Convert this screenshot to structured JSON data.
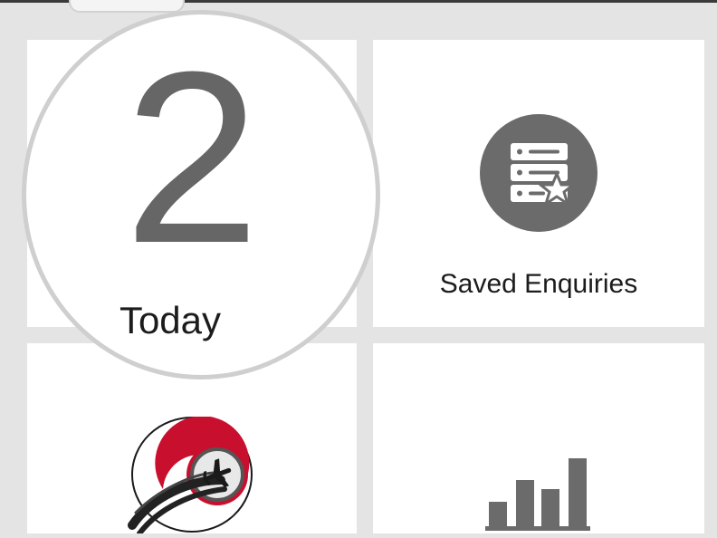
{
  "dashboard": {
    "today": {
      "count": "2",
      "label": "Today"
    },
    "saved_enquiries": {
      "label": "Saved Enquiries",
      "icon": "saved-enquiries-star-list-icon"
    },
    "travel": {
      "icon": "airplane-logo-icon"
    },
    "stats": {
      "icon": "bar-chart-icon"
    }
  },
  "colors": {
    "background": "#e4e4e4",
    "tile": "#ffffff",
    "icon_gray": "#6b6b6b",
    "highlight_ring": "#cfcfcf",
    "logo_red": "#c8102e"
  }
}
